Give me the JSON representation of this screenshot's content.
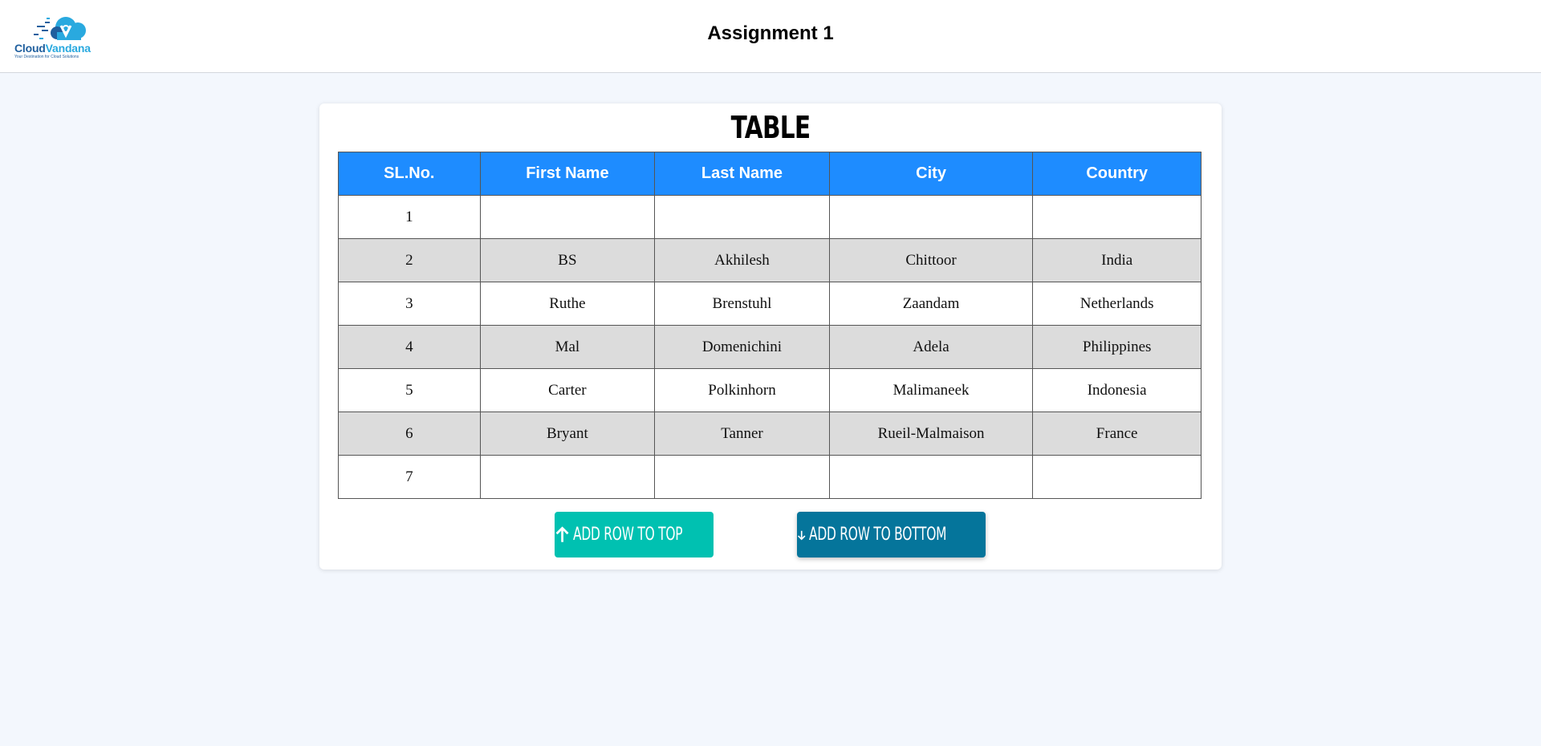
{
  "header": {
    "title": "Assignment 1",
    "logo": {
      "name_part1": "Cloud",
      "name_part2": "Vandana",
      "tagline": "Your Destination for Cloud Solutions",
      "colors": {
        "dark": "#1f5f9e",
        "light": "#29a9df"
      }
    }
  },
  "card": {
    "title": "TABLE"
  },
  "table": {
    "columns": [
      "SL.No.",
      "First Name",
      "Last Name",
      "City",
      "Country"
    ],
    "rows": [
      [
        "1",
        "",
        "",
        "",
        ""
      ],
      [
        "2",
        "BS",
        "Akhilesh",
        "Chittoor",
        "India"
      ],
      [
        "3",
        "Ruthe",
        "Brenstuhl",
        "Zaandam",
        "Netherlands"
      ],
      [
        "4",
        "Mal",
        "Domenichini",
        "Adela",
        "Philippines"
      ],
      [
        "5",
        "Carter",
        "Polkinhorn",
        "Malimaneek",
        "Indonesia"
      ],
      [
        "6",
        "Bryant",
        "Tanner",
        "Rueil-Malmaison",
        "France"
      ],
      [
        "7",
        "",
        "",
        "",
        ""
      ]
    ],
    "header_color": "#1e8cff",
    "stripe_color": "#dcdcdc"
  },
  "buttons": {
    "add_top": {
      "label": "ADD ROW TO TOP",
      "icon": "arrow-up-icon",
      "color": "#00c1b1"
    },
    "add_bottom": {
      "label": "ADD ROW TO BOTTOM",
      "icon": "arrow-down-icon",
      "color": "#05759b"
    }
  }
}
